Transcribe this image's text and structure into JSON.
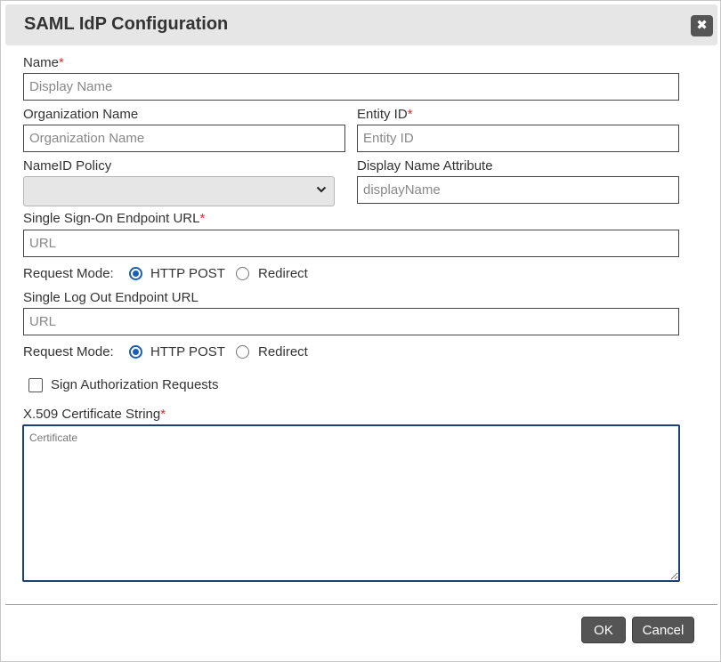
{
  "dialog": {
    "title": "SAML IdP Configuration",
    "close_glyph": "✖"
  },
  "fields": {
    "name": {
      "label": "Name",
      "required_mark": "*",
      "placeholder": "Display Name",
      "value": ""
    },
    "organization_name": {
      "label": "Organization Name",
      "placeholder": "Organization Name",
      "value": ""
    },
    "entity_id": {
      "label": "Entity ID",
      "required_mark": "*",
      "placeholder": "Entity ID",
      "value": ""
    },
    "nameid_policy": {
      "label": "NameID Policy",
      "selected": ""
    },
    "display_name_attribute": {
      "label": "Display Name Attribute",
      "placeholder": "displayName",
      "value": ""
    },
    "sso_url": {
      "label": "Single Sign-On Endpoint URL",
      "required_mark": "*",
      "placeholder": "URL",
      "value": ""
    },
    "sso_request_mode": {
      "label": "Request Mode:",
      "options": [
        "HTTP POST",
        "Redirect"
      ],
      "selected": "HTTP POST"
    },
    "slo_url": {
      "label": "Single Log Out Endpoint URL",
      "placeholder": "URL",
      "value": ""
    },
    "slo_request_mode": {
      "label": "Request Mode:",
      "options": [
        "HTTP POST",
        "Redirect"
      ],
      "selected": "HTTP POST"
    },
    "sign_auth_requests": {
      "label": "Sign Authorization Requests",
      "checked": false
    },
    "certificate": {
      "label": "X.509 Certificate String",
      "required_mark": "*",
      "placeholder": "Certificate",
      "value": ""
    }
  },
  "footer": {
    "ok_label": "OK",
    "cancel_label": "Cancel"
  },
  "colors": {
    "required": "#d0312d",
    "accent": "#1a5fb4",
    "button": "#555555",
    "titlebar": "#e6e6e6"
  },
  "icons": {
    "close": "close-icon",
    "dropdown": "chevron-down-icon",
    "resize": "resize-grip-icon"
  }
}
